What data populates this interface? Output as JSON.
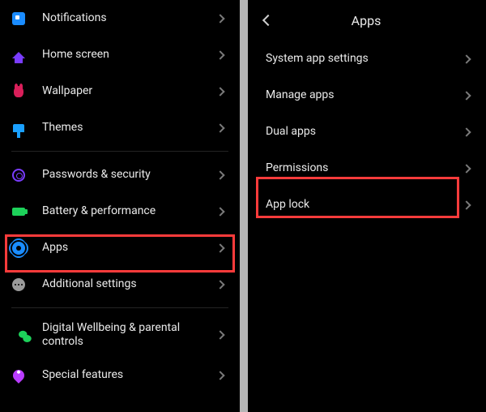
{
  "left_panel": {
    "group1": [
      {
        "icon": "notifications-icon",
        "label": "Notifications"
      },
      {
        "icon": "home-icon",
        "label": "Home screen"
      },
      {
        "icon": "wallpaper-icon",
        "label": "Wallpaper"
      },
      {
        "icon": "themes-icon",
        "label": "Themes"
      }
    ],
    "group2": [
      {
        "icon": "security-icon",
        "label": "Passwords & security"
      },
      {
        "icon": "battery-icon",
        "label": "Battery & performance"
      },
      {
        "icon": "apps-icon",
        "label": "Apps",
        "highlighted": true
      },
      {
        "icon": "additional-icon",
        "label": "Additional settings"
      }
    ],
    "group3": [
      {
        "icon": "wellbeing-icon",
        "label": "Digital Wellbeing & parental controls"
      },
      {
        "icon": "special-icon",
        "label": "Special features"
      }
    ]
  },
  "right_panel": {
    "title": "Apps",
    "items": [
      {
        "label": "System app settings"
      },
      {
        "label": "Manage apps"
      },
      {
        "label": "Dual apps"
      },
      {
        "label": "Permissions"
      },
      {
        "label": "App lock",
        "highlighted": true
      }
    ]
  },
  "highlights": {
    "color": "#ff3b3b"
  }
}
